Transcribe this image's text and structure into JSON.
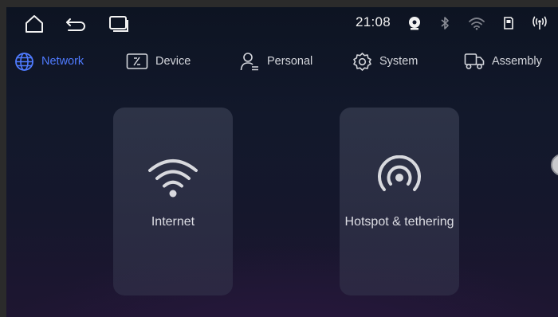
{
  "status_bar": {
    "time": "21:08",
    "nav_icons": [
      "home-icon",
      "back-icon",
      "recents-icon"
    ],
    "status_icons": [
      "usb-disc-icon",
      "bluetooth-icon",
      "wifi-icon",
      "sd-card-icon",
      "broadcast-icon"
    ]
  },
  "tabs": [
    {
      "label": "Network",
      "icon": "globe-icon",
      "active": true
    },
    {
      "label": "Device",
      "icon": "device-icon",
      "active": false
    },
    {
      "label": "Personal",
      "icon": "person-icon",
      "active": false
    },
    {
      "label": "System",
      "icon": "gear-icon",
      "active": false
    },
    {
      "label": "Assembly",
      "icon": "truck-icon",
      "active": false
    }
  ],
  "cards": [
    {
      "label": "Internet",
      "icon": "wifi-icon"
    },
    {
      "label": "Hotspot & tethering",
      "icon": "hotspot-icon"
    }
  ],
  "colors": {
    "accent": "#4f7bff",
    "text": "#d4d6dc",
    "background": "#12182b"
  }
}
